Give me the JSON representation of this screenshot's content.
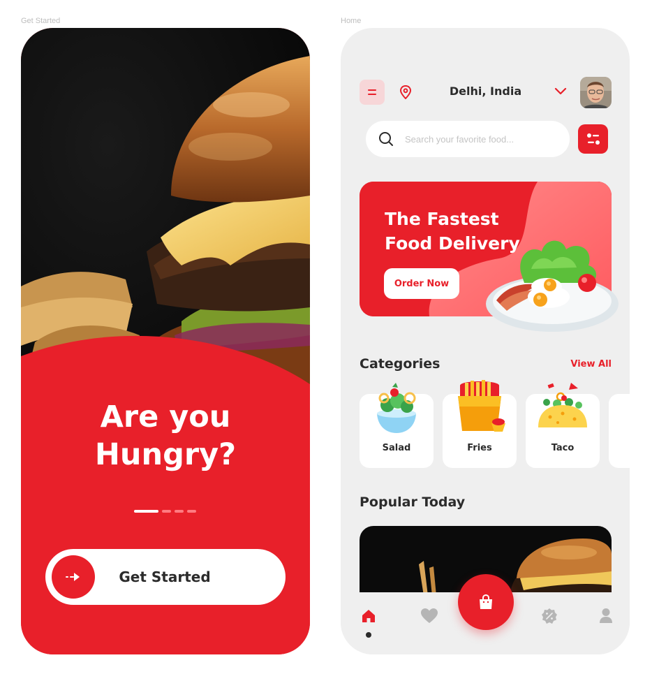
{
  "frames": {
    "left_label": "Get Started",
    "right_label": "Home"
  },
  "onboarding": {
    "title_line1": "Are you",
    "title_line2": "Hungry?",
    "pager_total": 4,
    "pager_active": 1,
    "get_started_label": "Get Started"
  },
  "home": {
    "location": "Delhi, India",
    "search": {
      "placeholder": "Search your favorite food..."
    },
    "banner": {
      "title_line1": "The Fastest",
      "title_line2": "Food Delivery",
      "cta_label": "Order Now"
    },
    "categories": {
      "title": "Categories",
      "view_all_label": "View All",
      "items": [
        {
          "label": "Salad",
          "icon": "salad-icon"
        },
        {
          "label": "Fries",
          "icon": "fries-icon"
        },
        {
          "label": "Taco",
          "icon": "taco-icon"
        }
      ]
    },
    "popular": {
      "title": "Popular Today"
    },
    "nav": {
      "items": [
        "home-icon",
        "heart-icon",
        "cart-icon",
        "discount-icon",
        "profile-icon"
      ],
      "active": "home-icon"
    }
  },
  "colors": {
    "accent": "#e8202a",
    "background": "#efefef",
    "text": "#2b2b2b"
  }
}
